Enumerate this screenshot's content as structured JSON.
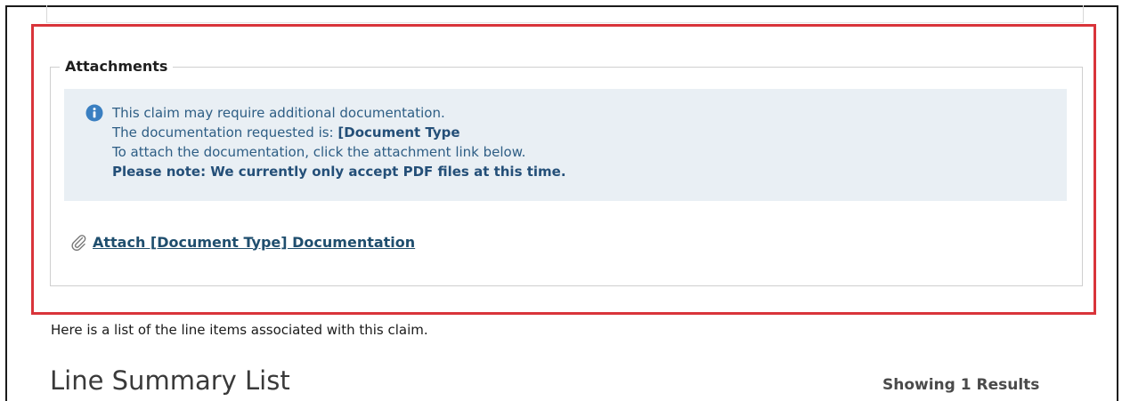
{
  "attachments": {
    "legend": "Attachments",
    "info": {
      "line1": "This claim may require additional documentation.",
      "line2_prefix": "The documentation requested is: ",
      "line2_value": "[Document Type",
      "line3": "To attach the documentation, click the attachment link below.",
      "line4": "Please note: We currently only accept PDF files at this time.",
      "icon": "info-icon"
    },
    "attach_link": {
      "icon": "paperclip-icon",
      "label": "Attach [Document Type] Documentation"
    }
  },
  "line_items": {
    "intro": "Here is a list of the line items associated with this claim.",
    "title": "Line Summary List",
    "results": "Showing 1 Results"
  },
  "colors": {
    "highlight": "#d9343a",
    "info_bg": "#e9eff4",
    "info_text": "#2d5d84",
    "info_icon": "#3a7fc1",
    "link": "#1f4e6e"
  }
}
